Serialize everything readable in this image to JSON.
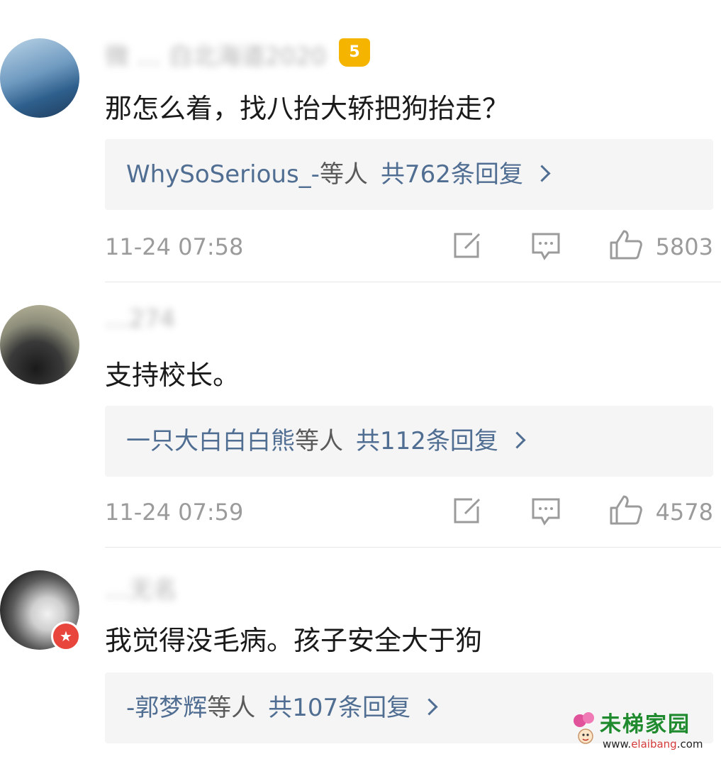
{
  "comments": [
    {
      "username_visible": "微 … 白北海道2020",
      "text": "那怎么着，找八抬大轿把狗抬走？",
      "replies_by": "WhySoSerious_-",
      "replies_etc": "等人",
      "replies_count": "共762条回复",
      "time": "11-24 07:58",
      "likes": "5803",
      "vip_badge": "5"
    },
    {
      "username_visible": "…274",
      "text": "支持校长。",
      "replies_by": "一只大白白白熊",
      "replies_etc": "等人",
      "replies_count": "共112条回复",
      "time": "11-24 07:59",
      "likes": "4578"
    },
    {
      "username_visible": "…无名",
      "text": "我觉得没毛病。孩子安全大于狗",
      "replies_by": "-郭梦辉",
      "replies_etc": "等人",
      "replies_count": "共107条回复"
    }
  ],
  "watermark": {
    "title": "未梯家园",
    "url_pre": "www.",
    "url_mid": "elaibang",
    "url_post": ".com"
  },
  "icons": {
    "share": "share-icon",
    "comment": "comment-icon",
    "like": "thumbs-up-icon",
    "verified": "verified-badge-icon",
    "vip": "crown-icon"
  }
}
